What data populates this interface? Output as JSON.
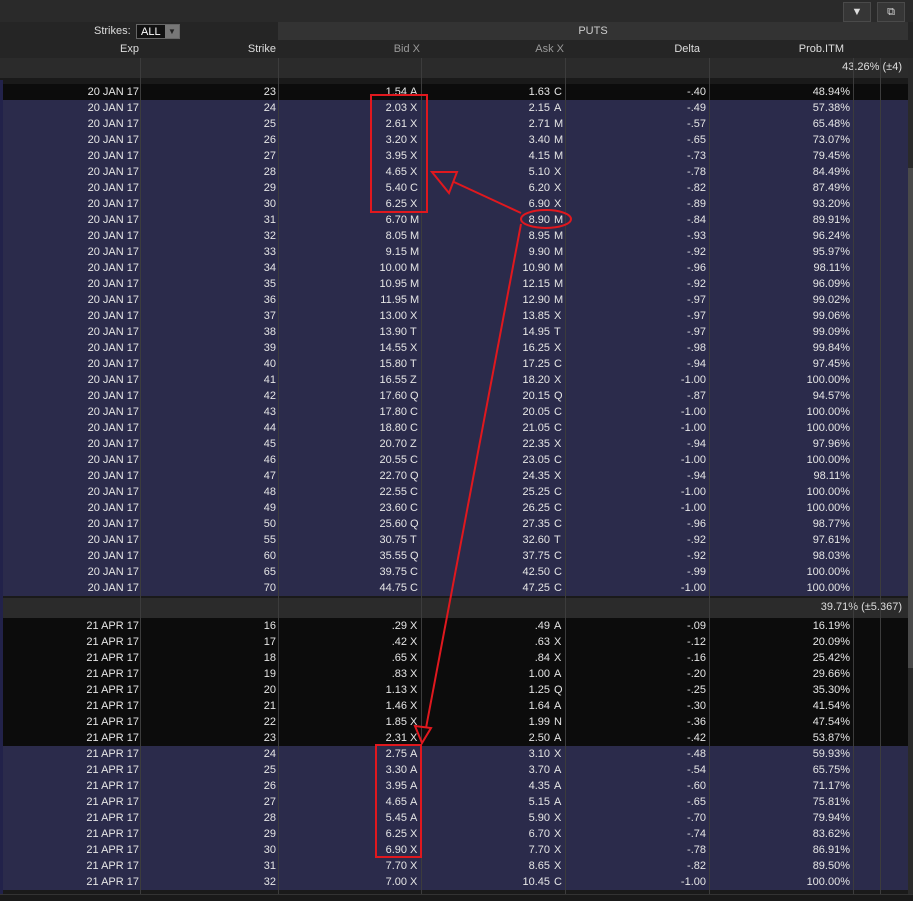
{
  "toolbar": {
    "collapse_icon": "triangle-down-icon",
    "popout_icon": "popout-icon"
  },
  "controls": {
    "strikes_label": "Strikes:",
    "strikes_value": "ALL"
  },
  "header": {
    "section": "PUTS",
    "cols": {
      "exp": "Exp",
      "strike": "Strike",
      "bid": "Bid X",
      "ask": "Ask X",
      "delta": "Delta",
      "prob": "Prob.ITM"
    }
  },
  "colors": {
    "row_dark": "#0c0c0c",
    "row_itm": "#2b2b4b",
    "annotation": "#e0181e"
  },
  "groups": [
    {
      "summary": "43.26% (±4)",
      "rows": [
        {
          "exp": "20 JAN 17",
          "strike": "23",
          "bid": "1.54",
          "bx": "A",
          "ask": "1.63",
          "ax": "C",
          "delta": "-.40",
          "prob": "48.94%",
          "itm": false
        },
        {
          "exp": "20 JAN 17",
          "strike": "24",
          "bid": "2.03",
          "bx": "X",
          "ask": "2.15",
          "ax": "A",
          "delta": "-.49",
          "prob": "57.38%",
          "itm": true
        },
        {
          "exp": "20 JAN 17",
          "strike": "25",
          "bid": "2.61",
          "bx": "X",
          "ask": "2.71",
          "ax": "M",
          "delta": "-.57",
          "prob": "65.48%",
          "itm": true
        },
        {
          "exp": "20 JAN 17",
          "strike": "26",
          "bid": "3.20",
          "bx": "X",
          "ask": "3.40",
          "ax": "M",
          "delta": "-.65",
          "prob": "73.07%",
          "itm": true
        },
        {
          "exp": "20 JAN 17",
          "strike": "27",
          "bid": "3.95",
          "bx": "X",
          "ask": "4.15",
          "ax": "M",
          "delta": "-.73",
          "prob": "79.45%",
          "itm": true
        },
        {
          "exp": "20 JAN 17",
          "strike": "28",
          "bid": "4.65",
          "bx": "X",
          "ask": "5.10",
          "ax": "X",
          "delta": "-.78",
          "prob": "84.49%",
          "itm": true
        },
        {
          "exp": "20 JAN 17",
          "strike": "29",
          "bid": "5.40",
          "bx": "C",
          "ask": "6.20",
          "ax": "X",
          "delta": "-.82",
          "prob": "87.49%",
          "itm": true
        },
        {
          "exp": "20 JAN 17",
          "strike": "30",
          "bid": "6.25",
          "bx": "X",
          "ask": "6.90",
          "ax": "X",
          "delta": "-.89",
          "prob": "93.20%",
          "itm": true
        },
        {
          "exp": "20 JAN 17",
          "strike": "31",
          "bid": "6.70",
          "bx": "M",
          "ask": "8.90",
          "ax": "M",
          "delta": "-.84",
          "prob": "89.91%",
          "itm": true
        },
        {
          "exp": "20 JAN 17",
          "strike": "32",
          "bid": "8.05",
          "bx": "M",
          "ask": "8.95",
          "ax": "M",
          "delta": "-.93",
          "prob": "96.24%",
          "itm": true
        },
        {
          "exp": "20 JAN 17",
          "strike": "33",
          "bid": "9.15",
          "bx": "M",
          "ask": "9.90",
          "ax": "M",
          "delta": "-.92",
          "prob": "95.97%",
          "itm": true
        },
        {
          "exp": "20 JAN 17",
          "strike": "34",
          "bid": "10.00",
          "bx": "M",
          "ask": "10.90",
          "ax": "M",
          "delta": "-.96",
          "prob": "98.11%",
          "itm": true
        },
        {
          "exp": "20 JAN 17",
          "strike": "35",
          "bid": "10.95",
          "bx": "M",
          "ask": "12.15",
          "ax": "M",
          "delta": "-.92",
          "prob": "96.09%",
          "itm": true
        },
        {
          "exp": "20 JAN 17",
          "strike": "36",
          "bid": "11.95",
          "bx": "M",
          "ask": "12.90",
          "ax": "M",
          "delta": "-.97",
          "prob": "99.02%",
          "itm": true
        },
        {
          "exp": "20 JAN 17",
          "strike": "37",
          "bid": "13.00",
          "bx": "X",
          "ask": "13.85",
          "ax": "X",
          "delta": "-.97",
          "prob": "99.06%",
          "itm": true
        },
        {
          "exp": "20 JAN 17",
          "strike": "38",
          "bid": "13.90",
          "bx": "T",
          "ask": "14.95",
          "ax": "T",
          "delta": "-.97",
          "prob": "99.09%",
          "itm": true
        },
        {
          "exp": "20 JAN 17",
          "strike": "39",
          "bid": "14.55",
          "bx": "X",
          "ask": "16.25",
          "ax": "X",
          "delta": "-.98",
          "prob": "99.84%",
          "itm": true
        },
        {
          "exp": "20 JAN 17",
          "strike": "40",
          "bid": "15.80",
          "bx": "T",
          "ask": "17.25",
          "ax": "C",
          "delta": "-.94",
          "prob": "97.45%",
          "itm": true
        },
        {
          "exp": "20 JAN 17",
          "strike": "41",
          "bid": "16.55",
          "bx": "Z",
          "ask": "18.20",
          "ax": "X",
          "delta": "-1.00",
          "prob": "100.00%",
          "itm": true
        },
        {
          "exp": "20 JAN 17",
          "strike": "42",
          "bid": "17.60",
          "bx": "Q",
          "ask": "20.15",
          "ax": "Q",
          "delta": "-.87",
          "prob": "94.57%",
          "itm": true
        },
        {
          "exp": "20 JAN 17",
          "strike": "43",
          "bid": "17.80",
          "bx": "C",
          "ask": "20.05",
          "ax": "C",
          "delta": "-1.00",
          "prob": "100.00%",
          "itm": true
        },
        {
          "exp": "20 JAN 17",
          "strike": "44",
          "bid": "18.80",
          "bx": "C",
          "ask": "21.05",
          "ax": "C",
          "delta": "-1.00",
          "prob": "100.00%",
          "itm": true
        },
        {
          "exp": "20 JAN 17",
          "strike": "45",
          "bid": "20.70",
          "bx": "Z",
          "ask": "22.35",
          "ax": "X",
          "delta": "-.94",
          "prob": "97.96%",
          "itm": true
        },
        {
          "exp": "20 JAN 17",
          "strike": "46",
          "bid": "20.55",
          "bx": "C",
          "ask": "23.05",
          "ax": "C",
          "delta": "-1.00",
          "prob": "100.00%",
          "itm": true
        },
        {
          "exp": "20 JAN 17",
          "strike": "47",
          "bid": "22.70",
          "bx": "Q",
          "ask": "24.35",
          "ax": "X",
          "delta": "-.94",
          "prob": "98.11%",
          "itm": true
        },
        {
          "exp": "20 JAN 17",
          "strike": "48",
          "bid": "22.55",
          "bx": "C",
          "ask": "25.25",
          "ax": "C",
          "delta": "-1.00",
          "prob": "100.00%",
          "itm": true
        },
        {
          "exp": "20 JAN 17",
          "strike": "49",
          "bid": "23.60",
          "bx": "C",
          "ask": "26.25",
          "ax": "C",
          "delta": "-1.00",
          "prob": "100.00%",
          "itm": true
        },
        {
          "exp": "20 JAN 17",
          "strike": "50",
          "bid": "25.60",
          "bx": "Q",
          "ask": "27.35",
          "ax": "C",
          "delta": "-.96",
          "prob": "98.77%",
          "itm": true
        },
        {
          "exp": "20 JAN 17",
          "strike": "55",
          "bid": "30.75",
          "bx": "T",
          "ask": "32.60",
          "ax": "T",
          "delta": "-.92",
          "prob": "97.61%",
          "itm": true
        },
        {
          "exp": "20 JAN 17",
          "strike": "60",
          "bid": "35.55",
          "bx": "Q",
          "ask": "37.75",
          "ax": "C",
          "delta": "-.92",
          "prob": "98.03%",
          "itm": true
        },
        {
          "exp": "20 JAN 17",
          "strike": "65",
          "bid": "39.75",
          "bx": "C",
          "ask": "42.50",
          "ax": "C",
          "delta": "-.99",
          "prob": "100.00%",
          "itm": true
        },
        {
          "exp": "20 JAN 17",
          "strike": "70",
          "bid": "44.75",
          "bx": "C",
          "ask": "47.25",
          "ax": "C",
          "delta": "-1.00",
          "prob": "100.00%",
          "itm": true
        }
      ]
    },
    {
      "summary": "39.71% (±5.367)",
      "rows": [
        {
          "exp": "21 APR 17",
          "strike": "16",
          "bid": ".29",
          "bx": "X",
          "ask": ".49",
          "ax": "A",
          "delta": "-.09",
          "prob": "16.19%",
          "itm": false
        },
        {
          "exp": "21 APR 17",
          "strike": "17",
          "bid": ".42",
          "bx": "X",
          "ask": ".63",
          "ax": "X",
          "delta": "-.12",
          "prob": "20.09%",
          "itm": false
        },
        {
          "exp": "21 APR 17",
          "strike": "18",
          "bid": ".65",
          "bx": "X",
          "ask": ".84",
          "ax": "X",
          "delta": "-.16",
          "prob": "25.42%",
          "itm": false
        },
        {
          "exp": "21 APR 17",
          "strike": "19",
          "bid": ".83",
          "bx": "X",
          "ask": "1.00",
          "ax": "A",
          "delta": "-.20",
          "prob": "29.66%",
          "itm": false
        },
        {
          "exp": "21 APR 17",
          "strike": "20",
          "bid": "1.13",
          "bx": "X",
          "ask": "1.25",
          "ax": "Q",
          "delta": "-.25",
          "prob": "35.30%",
          "itm": false
        },
        {
          "exp": "21 APR 17",
          "strike": "21",
          "bid": "1.46",
          "bx": "X",
          "ask": "1.64",
          "ax": "A",
          "delta": "-.30",
          "prob": "41.54%",
          "itm": false
        },
        {
          "exp": "21 APR 17",
          "strike": "22",
          "bid": "1.85",
          "bx": "X",
          "ask": "1.99",
          "ax": "N",
          "delta": "-.36",
          "prob": "47.54%",
          "itm": false
        },
        {
          "exp": "21 APR 17",
          "strike": "23",
          "bid": "2.31",
          "bx": "X",
          "ask": "2.50",
          "ax": "A",
          "delta": "-.42",
          "prob": "53.87%",
          "itm": false
        },
        {
          "exp": "21 APR 17",
          "strike": "24",
          "bid": "2.75",
          "bx": "A",
          "ask": "3.10",
          "ax": "X",
          "delta": "-.48",
          "prob": "59.93%",
          "itm": true
        },
        {
          "exp": "21 APR 17",
          "strike": "25",
          "bid": "3.30",
          "bx": "A",
          "ask": "3.70",
          "ax": "A",
          "delta": "-.54",
          "prob": "65.75%",
          "itm": true
        },
        {
          "exp": "21 APR 17",
          "strike": "26",
          "bid": "3.95",
          "bx": "A",
          "ask": "4.35",
          "ax": "A",
          "delta": "-.60",
          "prob": "71.17%",
          "itm": true
        },
        {
          "exp": "21 APR 17",
          "strike": "27",
          "bid": "4.65",
          "bx": "A",
          "ask": "5.15",
          "ax": "A",
          "delta": "-.65",
          "prob": "75.81%",
          "itm": true
        },
        {
          "exp": "21 APR 17",
          "strike": "28",
          "bid": "5.45",
          "bx": "A",
          "ask": "5.90",
          "ax": "X",
          "delta": "-.70",
          "prob": "79.94%",
          "itm": true
        },
        {
          "exp": "21 APR 17",
          "strike": "29",
          "bid": "6.25",
          "bx": "X",
          "ask": "6.70",
          "ax": "X",
          "delta": "-.74",
          "prob": "83.62%",
          "itm": true
        },
        {
          "exp": "21 APR 17",
          "strike": "30",
          "bid": "6.90",
          "bx": "X",
          "ask": "7.70",
          "ax": "X",
          "delta": "-.78",
          "prob": "86.91%",
          "itm": true
        },
        {
          "exp": "21 APR 17",
          "strike": "31",
          "bid": "7.70",
          "bx": "X",
          "ask": "8.65",
          "ax": "X",
          "delta": "-.82",
          "prob": "89.50%",
          "itm": true
        },
        {
          "exp": "21 APR 17",
          "strike": "32",
          "bid": "7.00",
          "bx": "X",
          "ask": "10.45",
          "ax": "C",
          "delta": "-1.00",
          "prob": "100.00%",
          "itm": true
        }
      ]
    }
  ]
}
